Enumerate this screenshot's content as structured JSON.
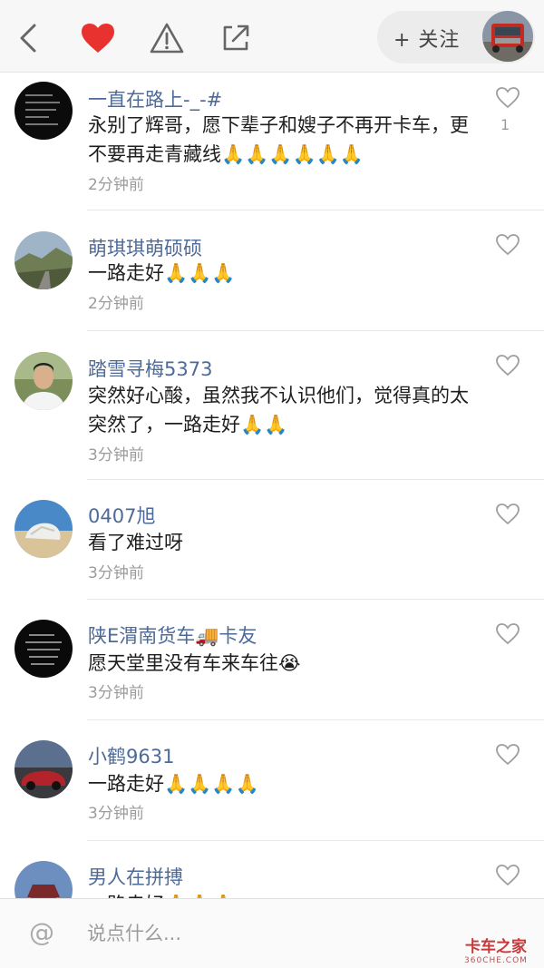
{
  "topbar": {
    "back_icon": "chevron-left-icon",
    "like_icon": "heart-filled-icon",
    "report_icon": "warning-icon",
    "share_icon": "share-icon",
    "follow_label": "+ 关注",
    "accent": "#e8322f"
  },
  "comments": [
    {
      "name": "一直在路上-_-#",
      "text": "永别了辉哥，愿下辈子和嫂子不再开卡车，更不要再走青藏线🙏🙏🙏🙏🙏🙏",
      "time": "2分钟前",
      "likes": "1"
    },
    {
      "name": "萌琪琪萌硕硕",
      "text": "一路走好🙏🙏🙏",
      "time": "2分钟前",
      "likes": ""
    },
    {
      "name": "踏雪寻梅5373",
      "text": "突然好心酸，虽然我不认识他们，觉得真的太突然了，一路走好🙏🙏",
      "time": "3分钟前",
      "likes": ""
    },
    {
      "name": "0407旭",
      "text": "看了难过呀",
      "time": "3分钟前",
      "likes": ""
    },
    {
      "name": "陕E渭南货车🚚卡友",
      "text": "愿天堂里没有车来车往😭",
      "time": "3分钟前",
      "likes": ""
    },
    {
      "name": "小鹤9631",
      "text": "一路走好🙏🙏🙏🙏",
      "time": "3分钟前",
      "likes": ""
    },
    {
      "name": "男人在拼搏",
      "text": "一路走好🙏🙏🙏",
      "time": "",
      "likes": ""
    }
  ],
  "bottombar": {
    "at_icon": "at-icon",
    "placeholder": "说点什么...",
    "watermark": "卡车之家",
    "watermark_sub": "360CHE.COM"
  }
}
